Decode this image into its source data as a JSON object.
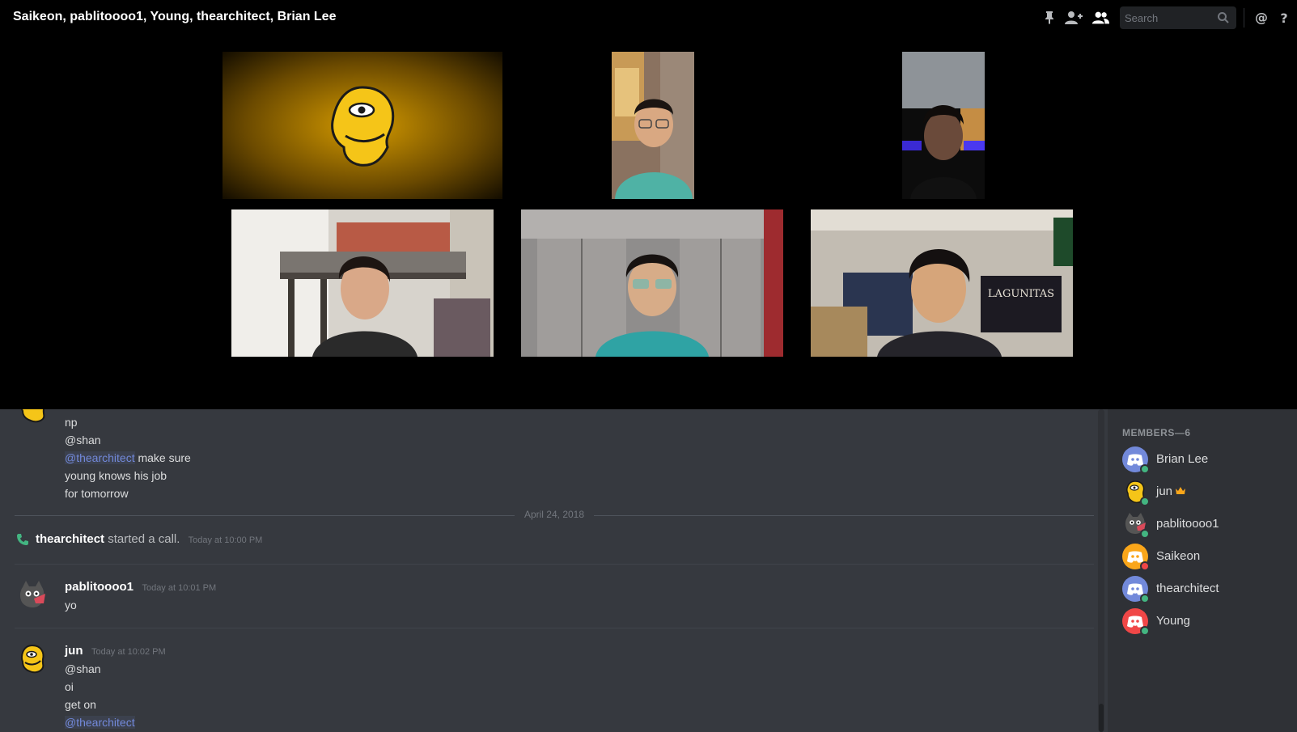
{
  "header": {
    "title": "Saikeon, pablitoooo1, Young, thearchitect, Brian Lee",
    "search_placeholder": "Search"
  },
  "icons": {
    "pin": "pin-icon",
    "add_member": "add-member-icon",
    "members": "members-icon",
    "search": "search-icon",
    "mention": "mention-icon",
    "help": "help-icon"
  },
  "colors": {
    "accent": "#7289da",
    "online": "#43b581",
    "dnd": "#f04747",
    "call_green": "#43b581"
  },
  "chat": {
    "continued_lines": [
      "np",
      "@shan",
      "make sure",
      "young knows his job",
      "for tomorrow"
    ],
    "continued_mention": "@thearchitect",
    "date_divider": "April 24, 2018",
    "system_message": {
      "user": "thearchitect",
      "text": "started a call.",
      "timestamp": "Today at 10:00 PM"
    },
    "messages": [
      {
        "author": "pablitoooo1",
        "timestamp": "Today at 10:01 PM",
        "lines": [
          "yo"
        ]
      },
      {
        "author": "jun",
        "timestamp": "Today at 10:02 PM",
        "lines": [
          "@shan",
          "oi",
          "get on"
        ],
        "mention": "@thearchitect"
      }
    ]
  },
  "members": {
    "header": "MEMBERS—6",
    "items": [
      {
        "name": "Brian Lee",
        "status": "online"
      },
      {
        "name": "jun",
        "status": "online",
        "badge": "crown-icon"
      },
      {
        "name": "pablitoooo1",
        "status": "online"
      },
      {
        "name": "Saikeon",
        "status": "dnd"
      },
      {
        "name": "thearchitect",
        "status": "online"
      },
      {
        "name": "Young",
        "status": "online"
      }
    ]
  }
}
